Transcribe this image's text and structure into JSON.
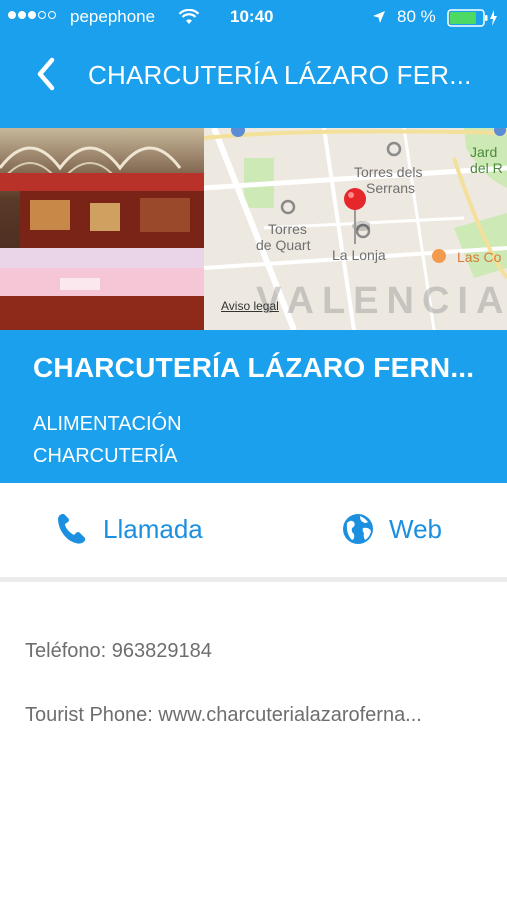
{
  "status": {
    "carrier": "pepephone",
    "time": "10:40",
    "battery": "80 %"
  },
  "nav": {
    "title": "CHARCUTERÍA LÁZARO FER..."
  },
  "map": {
    "labels": [
      "Torres dels",
      "Serrans",
      "Torres",
      "de Quart",
      "La Lonja",
      "Las Co",
      "Jard",
      "del R"
    ],
    "city": "VALENCIA",
    "legal": "Aviso legal"
  },
  "business": {
    "name": "CHARCUTERÍA LÁZARO FERN...",
    "category1": "ALIMENTACIÓN",
    "category2": "CHARCUTERÍA"
  },
  "actions": {
    "call": "Llamada",
    "web": "Web"
  },
  "info": {
    "phone": "Teléfono: 963829184",
    "tourist": "Tourist Phone: www.charcuterialazaroferna..."
  },
  "colors": {
    "brand": "#1aa0ec",
    "action": "#1d8fe0"
  }
}
